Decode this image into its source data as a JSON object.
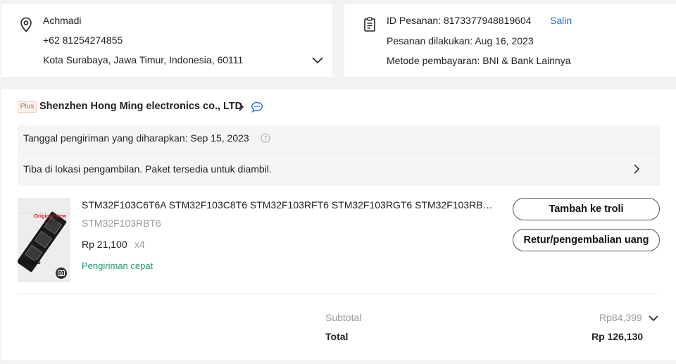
{
  "address": {
    "name": "Achmadi",
    "phone": "+62 81254274855",
    "line": "Kota Surabaya, Jawa Timur, Indonesia, 60111",
    "icon": "location-pin-icon",
    "expand_icon": "chevron-down-icon"
  },
  "order": {
    "id_text": "ID Pesanan: 8173377948819604",
    "copy_label": "Salin",
    "placed_text": "Pesanan dilakukan: Aug 16, 2023",
    "payment_text": "Metode pembayaran: BNI & Bank Lainnya",
    "icon": "clipboard-icon"
  },
  "store": {
    "badge": "Plus",
    "name": "Shenzhen Hong Ming electronics co., LTD",
    "chevron_icon": "chevron-right-icon",
    "chat_icon": "chat-bubble-icon"
  },
  "shipping": {
    "expected_text": "Tanggal pengiriman yang diharapkan: Sep 15, 2023",
    "help_icon": "question-circle-icon",
    "status_text": "Tiba di lokasi pengambilan. Paket tersedia untuk diambil."
  },
  "product": {
    "title": "STM32F103C6T6A STM32F103C8T6 STM32F103RFT6 STM32F103RGT6 STM32F103RBT6 STM32F103RCT6",
    "variant": "STM32F103RBT6",
    "price": "Rp 21,100",
    "qty": "x4",
    "fast_shipping": "Pengiriman cepat",
    "image_text": {
      "banner": "Original New",
      "quality": "100% quality",
      "brand": "SUHMS"
    },
    "image_icon": "camera-icon"
  },
  "actions": {
    "add_to_cart": "Tambah ke troli",
    "refund": "Retur/pengembalian uang"
  },
  "summary": {
    "subtotal_label": "Subtotal",
    "subtotal_value": "Rp84,399",
    "total_label": "Total",
    "total_value": "Rp 126,130"
  },
  "colors": {
    "link": "#1b6ff2",
    "fast_shipping": "#1a9a6c",
    "plus_badge": "#a06a55",
    "background": "#f2f2f2"
  }
}
